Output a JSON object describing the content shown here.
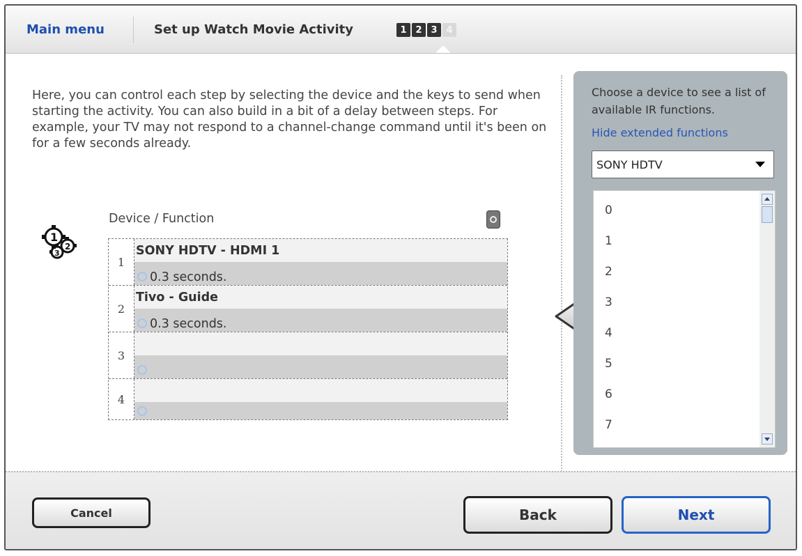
{
  "header": {
    "main_menu": "Main menu",
    "title": "Set up Watch Movie Activity",
    "steps": [
      "1",
      "2",
      "3",
      "4"
    ],
    "current_steps_completed": 3
  },
  "description": "Here, you can control each step by selecting the device and the keys to send when starting the activity. You can also build in a bit of a delay between steps. For example, your TV may not respond to a channel-change command until it's been on for a few seconds already.",
  "sequence": {
    "label": "Device / Function",
    "rows": [
      {
        "num": "1",
        "function": "SONY HDTV - HDMI 1",
        "delay": "0.3 seconds."
      },
      {
        "num": "2",
        "function": "Tivo - Guide",
        "delay": "0.3 seconds."
      },
      {
        "num": "3",
        "function": "",
        "delay": ""
      },
      {
        "num": "4",
        "function": "",
        "delay": ""
      }
    ]
  },
  "device_panel": {
    "info": "Choose a device to see a list of available IR functions.",
    "link": "Hide extended functions",
    "selected_device": "SONY HDTV",
    "functions": [
      "0",
      "1",
      "2",
      "3",
      "4",
      "5",
      "6",
      "7"
    ]
  },
  "footer": {
    "cancel": "Cancel",
    "back": "Back",
    "next": "Next"
  },
  "colors": {
    "accent": "#1f4fb0",
    "panel": "#adb6ba"
  }
}
